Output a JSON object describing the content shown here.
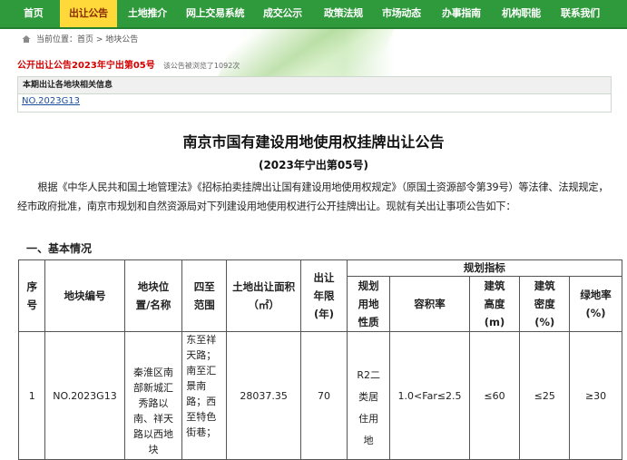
{
  "nav": {
    "items": [
      "首页",
      "出让公告",
      "土地推介",
      "网上交易系统",
      "成交公示",
      "政策法规",
      "市场动态",
      "办事指南",
      "机构职能",
      "联系我们"
    ],
    "active_index": 1
  },
  "breadcrumb": "当前位置：首页 > 地块公告",
  "headline": {
    "title": "公开出让公告2023年宁出第05号",
    "views": "该公告被浏览了1092次"
  },
  "info_box": {
    "header": "本期出让各地块相关信息",
    "link": "NO.2023G13"
  },
  "document": {
    "title": "南京市国有建设用地使用权挂牌出让公告",
    "subtitle": "(2023年宁出第05号)",
    "paragraph": "根据《中华人民共和国土地管理法》《招标拍卖挂牌出让国有建设用地使用权规定》（原国土资源部令第39号）等法律、法规规定，经市政府批准，南京市规划和自然资源局对下列建设用地使用权进行公开挂牌出让。现就有关出让事项公告如下：",
    "section": "一、基本情况"
  },
  "table": {
    "group_header": "规划指标",
    "headers": {
      "seq": "序号",
      "code": "地块编号",
      "location": "地块位置/名称",
      "bounds": "四至范围",
      "area": "土地出让面积（㎡）",
      "term": "出让年限(年)",
      "use": "规划用地性质",
      "far": "容积率",
      "height": "建筑高度(m)",
      "density": "建筑密度(%)",
      "green": "绿地率(%)"
    },
    "row": {
      "seq": "1",
      "code": "NO.2023G13",
      "location": "秦淮区南部新城汇秀路以南、祥天路以西地块",
      "bounds": "东至祥天路；南至汇景南路；西至特色街巷；",
      "area": "28037.35",
      "term": "70",
      "use": "R2二类居住用地",
      "far": "1.0<Far≤2.5",
      "height": "≤60",
      "density": "≤25",
      "green": "≥30"
    }
  },
  "colors": {
    "nav_green": "#2f9a3c",
    "nav_active": "#ffd83a",
    "headline_red": "#d40000",
    "link_blue": "#1a4f9c"
  }
}
